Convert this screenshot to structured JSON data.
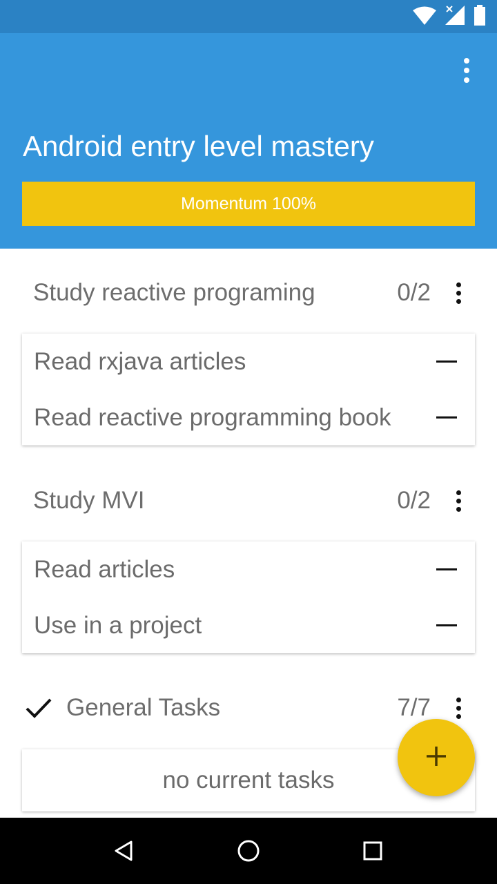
{
  "status_bar": {
    "icons": [
      "wifi-icon",
      "signal-icon",
      "battery-icon"
    ]
  },
  "header": {
    "title": "Android entry level mastery",
    "momentum_label": "Momentum 100%",
    "momentum_percent": 100,
    "color": "#3596dc",
    "momentum_color": "#f1c40f"
  },
  "sections": [
    {
      "title": "Study reactive programing",
      "count": "0/2",
      "tasks": [
        {
          "label": "Read rxjava articles"
        },
        {
          "label": "Read reactive programming book"
        }
      ]
    },
    {
      "title": "Study MVI",
      "count": "0/2",
      "tasks": [
        {
          "label": "Read articles"
        },
        {
          "label": "Use in a project"
        }
      ]
    },
    {
      "title": "General Tasks",
      "count": "7/7",
      "completed": true,
      "empty_text": "no current tasks"
    }
  ],
  "fab": {
    "icon": "plus-icon",
    "color": "#f1c40f"
  },
  "nav_bar": {
    "icons": [
      "back-icon",
      "home-icon",
      "recents-icon"
    ]
  }
}
